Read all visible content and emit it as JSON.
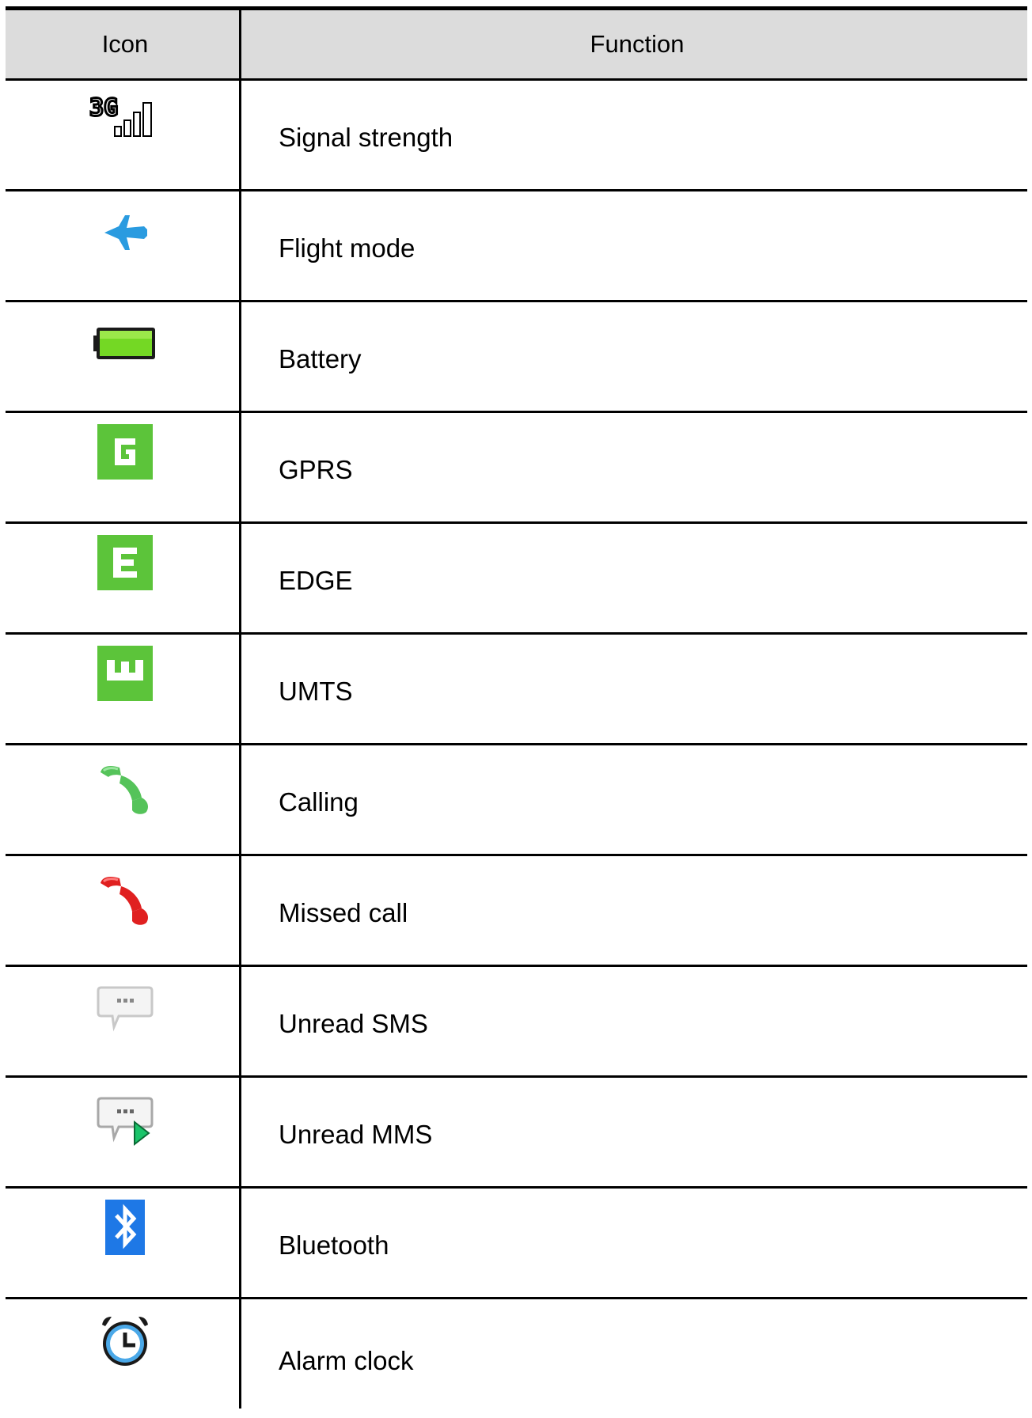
{
  "headers": {
    "icon": "Icon",
    "function": "Function"
  },
  "rows": [
    {
      "icon": "signal-3g-icon",
      "function": "Signal strength"
    },
    {
      "icon": "airplane-icon",
      "function": "Flight mode"
    },
    {
      "icon": "battery-icon",
      "function": "Battery"
    },
    {
      "icon": "gprs-icon",
      "function": "GPRS",
      "letter": "G"
    },
    {
      "icon": "edge-icon",
      "function": "EDGE",
      "letter": "E"
    },
    {
      "icon": "umts-icon",
      "function": "UMTS",
      "letter": "U"
    },
    {
      "icon": "calling-icon",
      "function": "Calling"
    },
    {
      "icon": "missed-call-icon",
      "function": "Missed call"
    },
    {
      "icon": "unread-sms-icon",
      "function": "Unread SMS"
    },
    {
      "icon": "unread-mms-icon",
      "function": "Unread MMS"
    },
    {
      "icon": "bluetooth-icon",
      "function": "Bluetooth"
    },
    {
      "icon": "alarm-clock-icon",
      "function": "Alarm clock"
    }
  ],
  "colors": {
    "header_bg": "#dcdcdc",
    "status_green": "#5cc43a",
    "airplane_blue": "#2a9be0",
    "call_green": "#55c35a",
    "missed_red": "#e02020",
    "bluetooth_blue": "#1e78e6"
  }
}
